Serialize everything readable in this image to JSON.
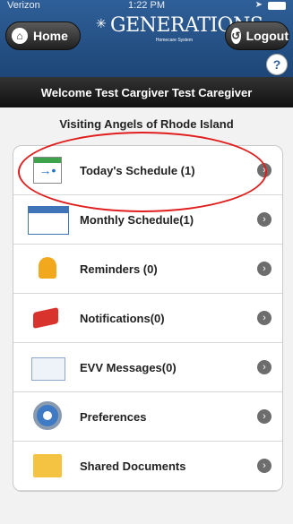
{
  "status_bar": {
    "carrier": "Verizon",
    "time": "1:22 PM"
  },
  "header": {
    "logo_text": "GENERATIONS",
    "logo_sub": "Homecare System",
    "home_label": "Home",
    "logout_label": "Logout",
    "help_label": "?"
  },
  "welcome": "Welcome Test Cargiver Test Caregiver",
  "agency": "Visiting Angels of Rhode Island",
  "menu": [
    {
      "label": "Today's Schedule (1)",
      "icon": "calendar-today-icon"
    },
    {
      "label": "Monthly Schedule(1)",
      "icon": "calendar-month-icon"
    },
    {
      "label": "Reminders (0)",
      "icon": "bell-icon"
    },
    {
      "label": "Notifications(0)",
      "icon": "megaphone-icon"
    },
    {
      "label": "EVV Messages(0)",
      "icon": "envelope-icon"
    },
    {
      "label": "Preferences",
      "icon": "gear-icon"
    },
    {
      "label": "Shared Documents",
      "icon": "folder-icon"
    }
  ],
  "colors": {
    "header": "#2f5f98",
    "highlight": "#e01e1e"
  }
}
